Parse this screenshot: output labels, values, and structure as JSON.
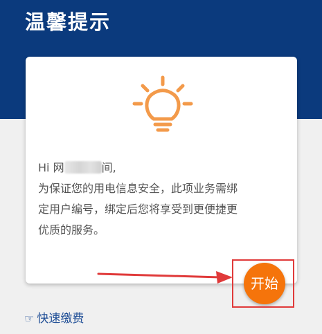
{
  "header": {
    "title": "温馨提示"
  },
  "card": {
    "icon": "lightbulb-icon",
    "greeting_prefix": "Hi 网",
    "greeting_suffix": "间,",
    "message_lines": [
      "为保证您的用电信息安全，此项业务需绑",
      "定用户编号，绑定后您将享受到更便捷更",
      "优质的服务。"
    ]
  },
  "start_button": {
    "label": "开始"
  },
  "quick_pay": {
    "icon": "pointing-hand-icon",
    "label": "快速缴费"
  },
  "colors": {
    "header_bg": "#0b3a7d",
    "accent_orange": "#f5740b",
    "highlight_red": "#e03a3a",
    "link_blue": "#1f4e96"
  }
}
